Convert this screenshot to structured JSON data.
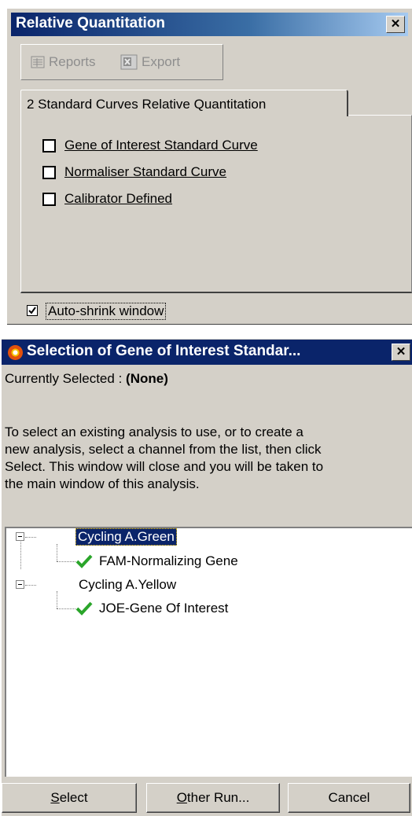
{
  "window1": {
    "title": "Relative Quantitation",
    "toolbar": {
      "reports_label": "Reports",
      "export_label": "Export"
    },
    "tab_label": "2 Standard Curves Relative Quantitation",
    "items": [
      {
        "label": "Gene of Interest Standard Curve",
        "checked": false
      },
      {
        "label": "Normaliser Standard Curve",
        "checked": false
      },
      {
        "label": "Calibrator Defined",
        "checked": false
      }
    ],
    "auto_shrink": {
      "label": "Auto-shrink window",
      "checked": true
    }
  },
  "window2": {
    "title": "Selection of Gene of Interest Standar...",
    "currently_selected_label": "Currently Selected :",
    "currently_selected_value": "(None)",
    "instructions": [
      "To select an existing analysis to use, or to create a",
      "new analysis, select a channel from the list, then click",
      "Select. This window will close and you will be taken to",
      "the main window of this analysis."
    ],
    "tree": [
      {
        "label": "Cycling A.Green",
        "selected": true,
        "children": [
          {
            "label": "FAM-Normalizing Gene"
          }
        ]
      },
      {
        "label": "Cycling A.Yellow",
        "selected": false,
        "children": [
          {
            "label": "JOE-Gene Of Interest"
          }
        ]
      }
    ],
    "buttons": {
      "select_accel": "S",
      "select_rest": "elect",
      "other_accel": "O",
      "other_rest": "ther Run...",
      "cancel": "Cancel"
    }
  },
  "colors": {
    "titlebar": "#0a246a",
    "check": "#2aa52a",
    "face": "#d4d0c8"
  },
  "icons": [
    "close-icon",
    "reports-icon",
    "export-icon",
    "app-icon",
    "checkmark-icon"
  ]
}
